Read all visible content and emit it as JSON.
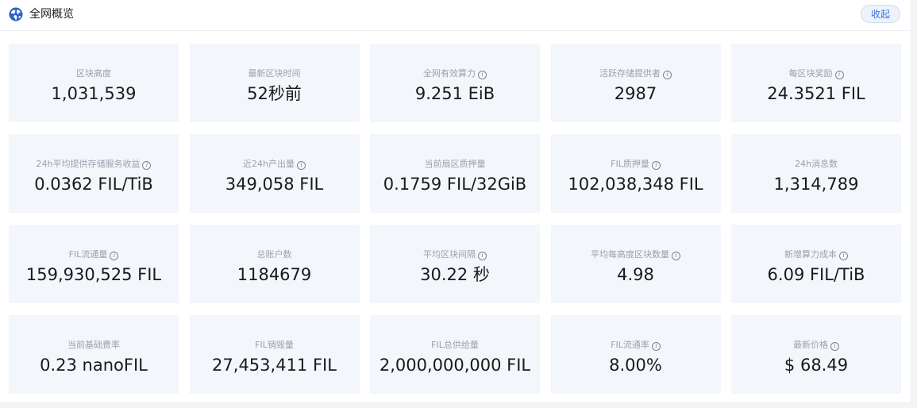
{
  "header": {
    "title": "全网概览",
    "collapse_label": "收起"
  },
  "cards": [
    {
      "label": "区块高度",
      "value": "1,031,539",
      "info": false
    },
    {
      "label": "最新区块时间",
      "value": "52秒前",
      "info": false
    },
    {
      "label": "全网有效算力",
      "value": "9.251 EiB",
      "info": true
    },
    {
      "label": "活跃存储提供者",
      "value": "2987",
      "info": true
    },
    {
      "label": "每区块奖励",
      "value": "24.3521 FIL",
      "info": true
    },
    {
      "label": "24h平均提供存储服务收益",
      "value": "0.0362 FIL/TiB",
      "info": true
    },
    {
      "label": "近24h产出量",
      "value": "349,058 FIL",
      "info": true
    },
    {
      "label": "当前扇区质押量",
      "value": "0.1759 FIL/32GiB",
      "info": false
    },
    {
      "label": "FIL质押量",
      "value": "102,038,348 FIL",
      "info": true
    },
    {
      "label": "24h消息数",
      "value": "1,314,789",
      "info": false
    },
    {
      "label": "FIL流通量",
      "value": "159,930,525 FIL",
      "info": true
    },
    {
      "label": "总账户数",
      "value": "1184679",
      "info": false
    },
    {
      "label": "平均区块间隔",
      "value": "30.22 秒",
      "info": true
    },
    {
      "label": "平均每高度区块数量",
      "value": "4.98",
      "info": true
    },
    {
      "label": "新增算力成本",
      "value": "6.09 FIL/TiB",
      "info": true
    },
    {
      "label": "当前基础费率",
      "value": "0.23 nanoFIL",
      "info": false
    },
    {
      "label": "FIL销毁量",
      "value": "27,453,411 FIL",
      "info": false
    },
    {
      "label": "FIL总供给量",
      "value": "2,000,000,000 FIL",
      "info": false
    },
    {
      "label": "FIL流通率",
      "value": "8.00%",
      "info": true
    },
    {
      "label": "最新价格",
      "value": "$ 68.49",
      "info": true
    }
  ],
  "icons": {
    "header": "globe-icon",
    "info": "info-icon"
  },
  "colors": {
    "card_bg": "#f3f6fb",
    "accent": "#3b6fd4",
    "label": "#9aa1ad",
    "value": "#1a1a1a"
  }
}
